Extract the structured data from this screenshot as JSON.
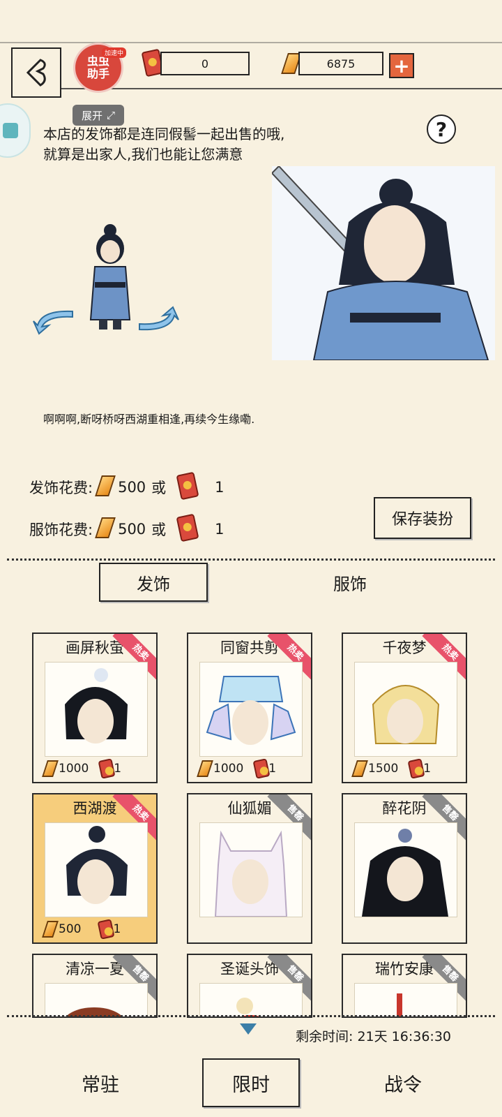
{
  "header": {
    "assist_label": "虫虫助手",
    "assist_badge": "加速中",
    "expand_label": "展开",
    "tickets": "0",
    "gold": "6875"
  },
  "dialog": {
    "intro": "本店的发饰都是连同假髻一起出售的哦,就算是出家人,我们也能让您满意",
    "quote": "啊啊啊,断呀桥呀西湖重相逢,再续今生缘嘞."
  },
  "costs": {
    "hair_label": "发饰花费:",
    "cloth_label": "服饰花费:",
    "gold_cost": "500",
    "or": "或",
    "ticket_cost": "1",
    "save_label": "保存装扮"
  },
  "tabs": [
    "发饰",
    "服饰"
  ],
  "items": [
    {
      "name": "画屏秋萤",
      "tag": "热卖",
      "gold": "1000",
      "ticket": "1"
    },
    {
      "name": "同窗共剪",
      "tag": "热卖",
      "gold": "1000",
      "ticket": "1"
    },
    {
      "name": "千夜梦",
      "tag": "热卖",
      "gold": "1500",
      "ticket": "1"
    },
    {
      "name": "西湖渡",
      "tag": "热卖",
      "gold": "500",
      "ticket": "1"
    },
    {
      "name": "仙狐媚",
      "tag": "售罄"
    },
    {
      "name": "醉花阴",
      "tag": "售罄"
    },
    {
      "name": "清凉一夏",
      "tag": "售罄"
    },
    {
      "name": "圣诞头饰",
      "tag": "售罄"
    },
    {
      "name": "瑞竹安康",
      "tag": "售罄"
    }
  ],
  "footer": {
    "timer_label": "剩余时间:",
    "timer_value": "21天 16:36:30",
    "tabs": [
      "常驻",
      "限时",
      "战令"
    ]
  },
  "colors": {
    "background": "#f8f1e0",
    "hot_ribbon": "#e8526a",
    "soldout_ribbon": "#8a8a8a",
    "selected_card": "#f6cd7c"
  }
}
